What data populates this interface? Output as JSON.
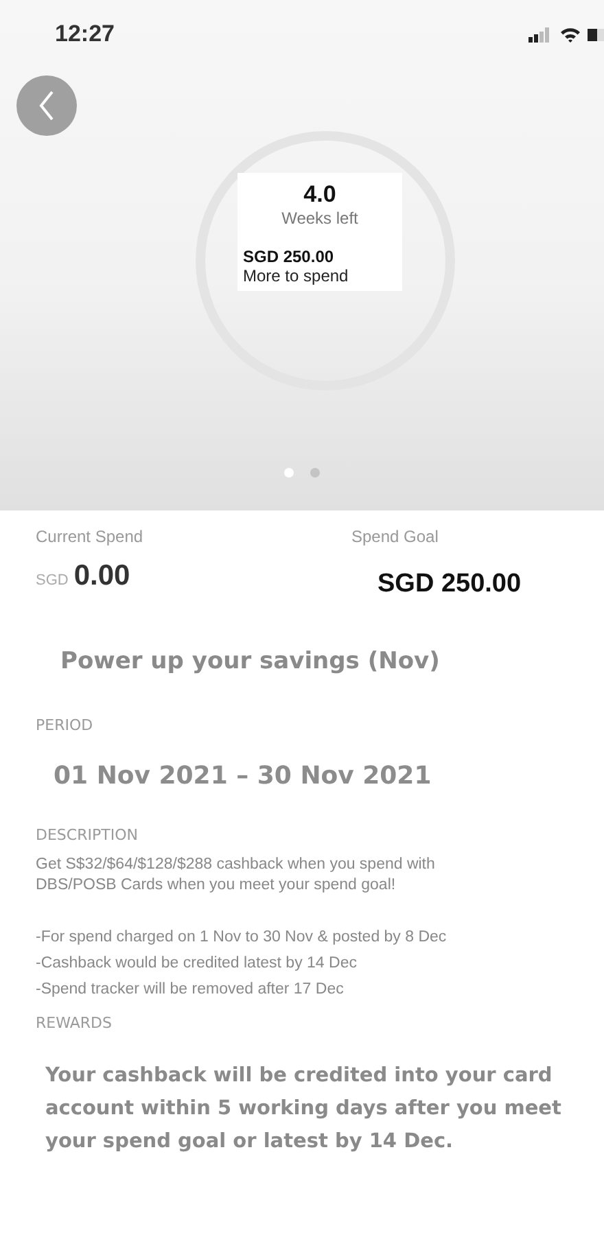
{
  "status_bar": {
    "time": "12:27"
  },
  "tracker": {
    "weeks": "4.0",
    "weeks_label": "Weeks left",
    "remaining": "SGD 250.00",
    "remaining_label": "More to spend"
  },
  "pager": [
    {
      "selected": true
    },
    {
      "selected": false
    }
  ],
  "summary": {
    "current_label": "Current Spend",
    "current_currency": "SGD",
    "current_value": "0.00",
    "goal_label": "Spend Goal",
    "goal_value": "SGD 250.00"
  },
  "title": "Power up your savings (Nov)",
  "period": {
    "label": "PERIOD",
    "value": "01 Nov 2021 – 30 Nov 2021"
  },
  "description": {
    "label": "DESCRIPTION",
    "text": "Get S$32/$64/$128/$288 cashback when you spend with DBS/POSB Cards when you meet your spend goal!",
    "bullets": [
      "-For spend charged on 1 Nov to 30 Nov & posted by 8 Dec",
      "-Cashback would be credited latest by 14 Dec",
      "-Spend tracker will be removed after 17 Dec"
    ]
  },
  "rewards": {
    "label": "REWARDS",
    "text": "Your cashback will be credited into your card account within 5 working days after you meet your spend goal or latest by 14 Dec."
  }
}
